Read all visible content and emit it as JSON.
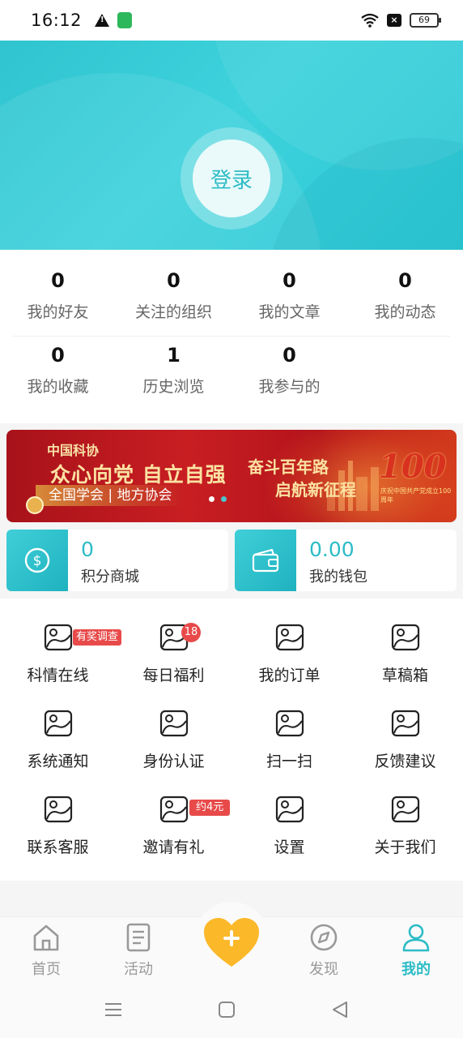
{
  "status_bar": {
    "time": "16:12",
    "battery": "69"
  },
  "header": {
    "login_label": "登录"
  },
  "stats": {
    "row1": [
      {
        "value": "0",
        "label": "我的好友"
      },
      {
        "value": "0",
        "label": "关注的组织"
      },
      {
        "value": "0",
        "label": "我的文章"
      },
      {
        "value": "0",
        "label": "我的动态"
      }
    ],
    "row2": [
      {
        "value": "0",
        "label": "我的收藏"
      },
      {
        "value": "1",
        "label": "历史浏览"
      },
      {
        "value": "0",
        "label": "我参与的"
      }
    ]
  },
  "banner": {
    "org": "中国科协",
    "slogan1": "众心向党 自立自强",
    "slogan2": "奋斗百年路",
    "slogan3": "启航新征程",
    "sub": "全国学会 | 地方协会",
    "emblem_text": "100",
    "emblem_sub": "庆祝中国共产党成立100周年"
  },
  "cards": {
    "points": {
      "value": "0",
      "label": "积分商城"
    },
    "wallet": {
      "value": "0.00",
      "label": "我的钱包"
    }
  },
  "menu": {
    "items": [
      {
        "label": "科情在线",
        "tag": "有奖调查"
      },
      {
        "label": "每日福利",
        "count": "18"
      },
      {
        "label": "我的订单"
      },
      {
        "label": "草稿箱"
      },
      {
        "label": "系统通知"
      },
      {
        "label": "身份认证"
      },
      {
        "label": "扫一扫"
      },
      {
        "label": "反馈建议"
      },
      {
        "label": "联系客服"
      },
      {
        "label": "邀请有礼",
        "tag": "约4元"
      },
      {
        "label": "设置"
      },
      {
        "label": "关于我们"
      }
    ]
  },
  "tabbar": {
    "tabs": [
      {
        "label": "首页",
        "icon": "home-icon"
      },
      {
        "label": "活动",
        "icon": "document-icon"
      },
      {
        "label": "发现",
        "icon": "compass-icon"
      },
      {
        "label": "我的",
        "icon": "user-icon",
        "active": true
      }
    ],
    "center_icon": "heart-plus-icon"
  },
  "colors": {
    "accent": "#2cbcc6",
    "badge": "#e84a4a",
    "fab": "#fbb829"
  }
}
